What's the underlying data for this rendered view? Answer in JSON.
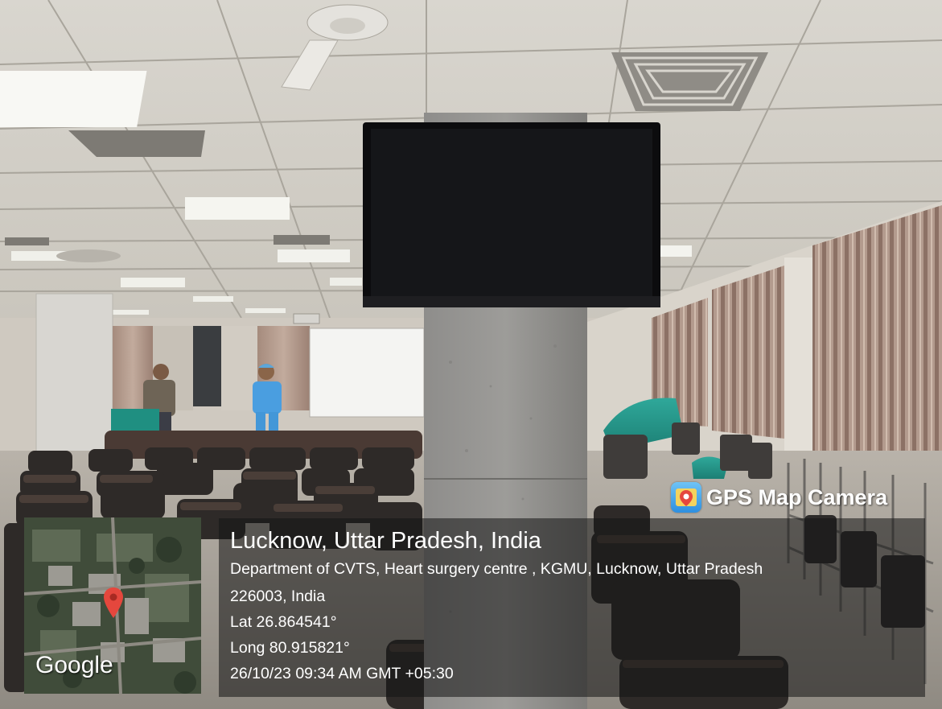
{
  "overlay": {
    "app_name": "GPS Map Camera",
    "location_title": "Lucknow, Uttar Pradesh, India",
    "address_line1": "Department of CVTS, Heart surgery centre , KGMU, Lucknow, Uttar Pradesh",
    "address_line2": "226003, India",
    "latitude": "Lat 26.864541°",
    "longitude": "Long 80.915821°",
    "timestamp": "26/10/23 09:34 AM GMT +05:30",
    "map_logo": "Google"
  },
  "icons": {
    "app": "gps-map-camera-app-icon",
    "pin": "map-location-pin-icon"
  },
  "colors": {
    "overlay_text": "#ffffff",
    "pin": "#e5473d",
    "overlay_panel": "#141414"
  }
}
